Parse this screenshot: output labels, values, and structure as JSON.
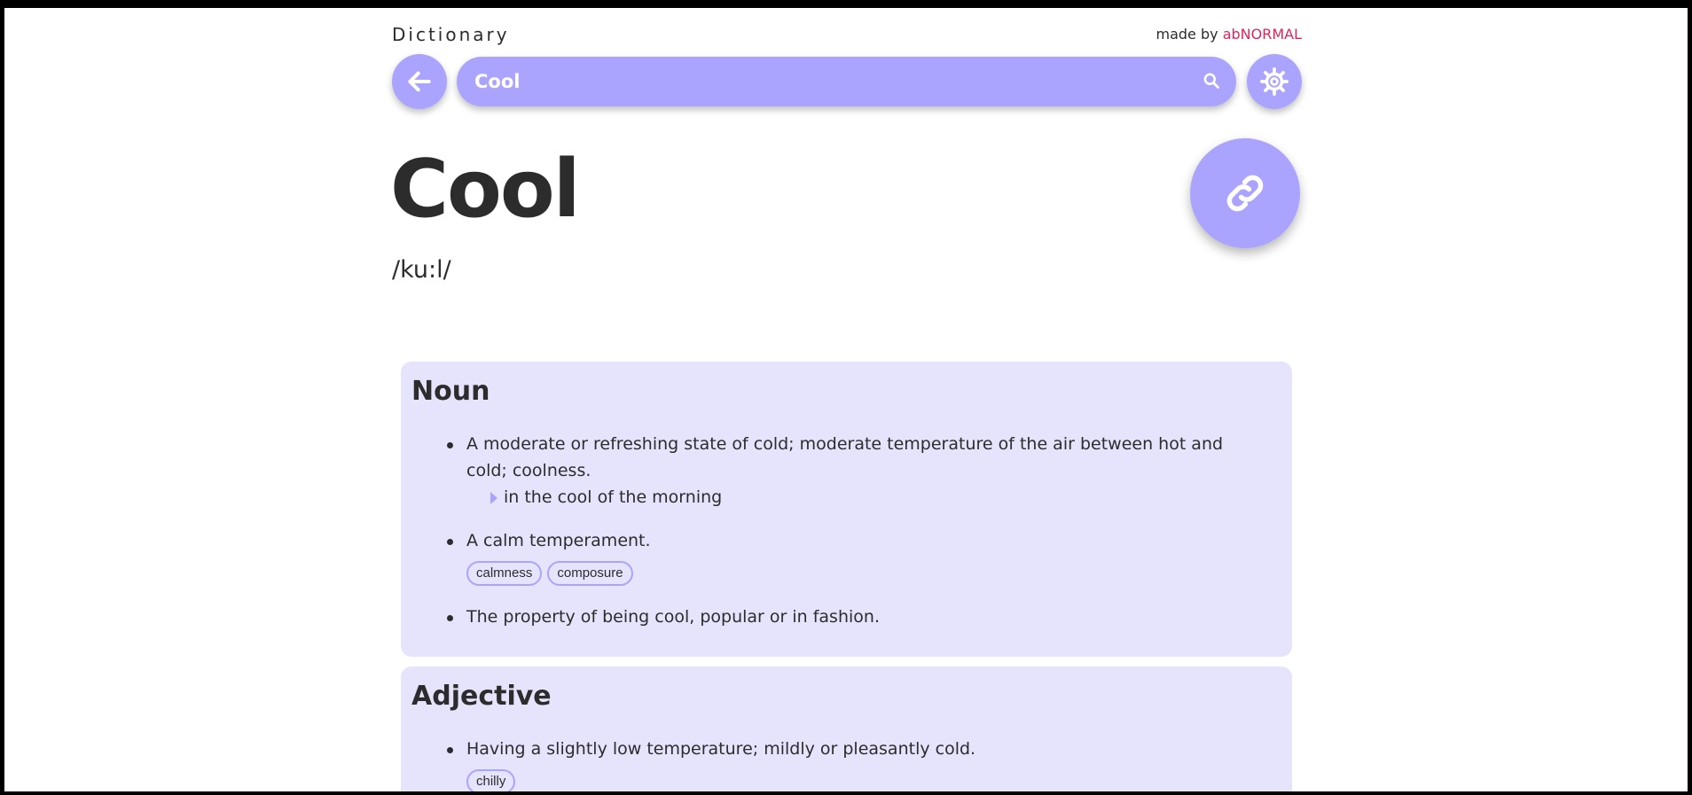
{
  "header": {
    "app_title": "Dictionary",
    "credit_prefix": "made by ",
    "credit_brand": "abNORMAL"
  },
  "search": {
    "value": "Cool",
    "placeholder": ""
  },
  "icons": {
    "back": "arrow-left-icon",
    "search": "search-icon",
    "settings": "gear-icon",
    "link": "link-icon"
  },
  "colors": {
    "accent": "#aba4ff",
    "card_background": "#e6e4fd",
    "brand": "#e0245e",
    "text": "#2c2c2c"
  },
  "entry": {
    "word": "Cool",
    "phonetic": "/ku:l/",
    "meanings": [
      {
        "part_of_speech": "Noun",
        "definitions": [
          {
            "text": "A moderate or refreshing state of cold; moderate temperature of the air between hot and cold; coolness.",
            "example": "in the cool of the morning"
          },
          {
            "text": "A calm temperament.",
            "synonyms": [
              "calmness",
              "composure"
            ]
          },
          {
            "text": "The property of being cool, popular or in fashion."
          }
        ]
      },
      {
        "part_of_speech": "Adjective",
        "definitions": [
          {
            "text": "Having a slightly low temperature; mildly or pleasantly cold.",
            "synonyms": [
              "chilly"
            ]
          }
        ]
      }
    ]
  }
}
